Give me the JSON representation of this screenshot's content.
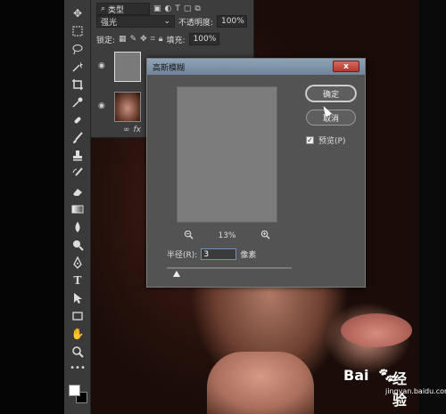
{
  "panel": {
    "search_label": "类型",
    "blend_mode": "强光",
    "opacity_label": "不透明度:",
    "opacity_value": "100%",
    "lock_label": "锁定:",
    "fill_label": "填充:",
    "fill_value": "100%",
    "link_icon_text": "∞",
    "fx_text": "fx"
  },
  "dialog": {
    "title": "高斯模糊",
    "close_label": "x",
    "ok_label": "确定",
    "cancel_label": "取消",
    "preview_label": "预览(P)",
    "preview_checked": true,
    "zoom_level": "13%",
    "radius_label": "半径(R):",
    "radius_value": "3",
    "radius_unit": "像素",
    "slider_fraction": 0.08
  },
  "watermark": {
    "text_bai": "Bai",
    "text_jingyan": "经验",
    "url": "jingyan.baidu.com"
  },
  "tools": [
    "move-icon",
    "marquee-icon",
    "lasso-icon",
    "magic-wand-icon",
    "crop-icon",
    "eyedropper-icon",
    "healing-icon",
    "brush-icon",
    "stamp-icon",
    "history-brush-icon",
    "eraser-icon",
    "gradient-icon",
    "blur-icon",
    "dodge-icon",
    "pen-icon",
    "type-icon",
    "path-select-icon",
    "rectangle-icon",
    "hand-icon",
    "zoom-icon",
    "more-icon"
  ],
  "colors": {
    "accent_ok_border": "#dddddd",
    "close_red": "#b13a2f",
    "titlebar": "#8fa3b8"
  }
}
